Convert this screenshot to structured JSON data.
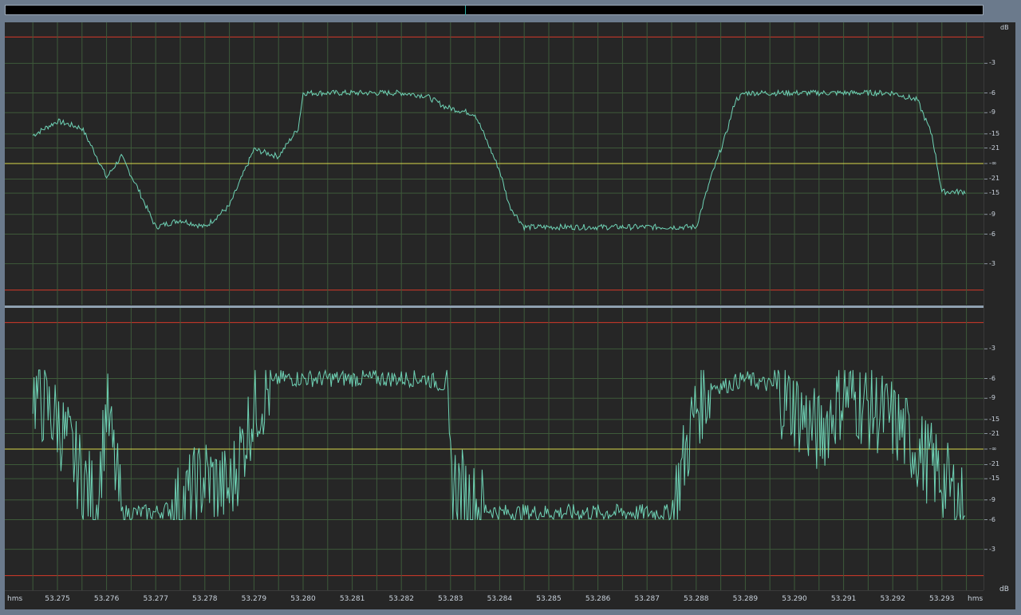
{
  "overview": {
    "playhead_fraction": 0.47
  },
  "display": {
    "db_unit": "dB",
    "time_unit": "hms",
    "colors": {
      "background": "#262626",
      "grid": "#3e5a3a",
      "waveform": "#6fd3b6",
      "clip_line": "#d43a2a",
      "center_line": "#d8d84a",
      "text": "#c9d2dc"
    }
  },
  "channels": [
    {
      "name": "top-channel",
      "db_labels": [
        "-3",
        "-6",
        "-9",
        "-15",
        "-21",
        "-∞",
        "-21",
        "-15",
        "-9",
        "-6",
        "-3"
      ]
    },
    {
      "name": "bottom-channel",
      "db_labels": [
        "-3",
        "-6",
        "-9",
        "-15",
        "-21",
        "-∞",
        "-21",
        "-15",
        "-9",
        "-6",
        "-3"
      ]
    }
  ],
  "time_axis": {
    "ticks": [
      "53.275",
      "53.276",
      "53.277",
      "53.278",
      "53.279",
      "53.280",
      "53.281",
      "53.282",
      "53.283",
      "53.284",
      "53.285",
      "53.286",
      "53.287",
      "53.288",
      "53.289",
      "53.290",
      "53.291",
      "53.292",
      "53.293"
    ]
  },
  "chart_data": {
    "type": "line",
    "xlabel": "hms",
    "ylabel": "dB",
    "series": [
      {
        "values_time": [
          53.2745,
          53.275,
          53.2755,
          53.2758,
          53.276,
          53.2763,
          53.2766,
          53.277,
          53.2775,
          53.278,
          53.2785,
          53.279,
          53.2795,
          53.2799,
          53.28,
          53.2805,
          53.281,
          53.2815,
          53.282,
          53.2825,
          53.2829,
          53.2835,
          53.284,
          53.2842,
          53.2845,
          53.285,
          53.2855,
          53.286,
          53.2865,
          53.287,
          53.2875,
          53.288,
          53.2883,
          53.2886,
          53.2888,
          53.289,
          53.2895,
          53.29,
          53.2905,
          53.291,
          53.2915,
          53.292,
          53.2925,
          53.2928,
          53.293,
          53.2935
        ],
        "values_amp": [
          0.2,
          0.3,
          0.25,
          0.05,
          -0.1,
          0.05,
          -0.15,
          -0.45,
          -0.4,
          -0.45,
          -0.3,
          0.1,
          0.05,
          0.25,
          0.5,
          0.5,
          0.5,
          0.5,
          0.5,
          0.48,
          0.4,
          0.35,
          -0.05,
          -0.3,
          -0.45,
          -0.45,
          -0.45,
          -0.45,
          -0.45,
          -0.45,
          -0.45,
          -0.45,
          -0.1,
          0.2,
          0.45,
          0.5,
          0.5,
          0.5,
          0.5,
          0.5,
          0.5,
          0.5,
          0.45,
          0.2,
          -0.2,
          -0.2
        ]
      },
      {
        "values_time": [
          53.2745,
          53.275,
          53.2755,
          53.2758,
          53.276,
          53.2763,
          53.2766,
          53.277,
          53.2775,
          53.278,
          53.2785,
          53.279,
          53.2795,
          53.28,
          53.2805,
          53.281,
          53.2815,
          53.282,
          53.2825,
          53.2829,
          53.283,
          53.2835,
          53.284,
          53.2845,
          53.285,
          53.2855,
          53.286,
          53.2865,
          53.287,
          53.2875,
          53.288,
          53.2883,
          53.2886,
          53.289,
          53.2895,
          53.29,
          53.2905,
          53.291,
          53.2915,
          53.292,
          53.2925,
          53.293,
          53.2935
        ],
        "values_amp": [
          0.4,
          0.2,
          -0.2,
          -0.4,
          0.3,
          -0.45,
          -0.45,
          -0.45,
          -0.4,
          -0.2,
          -0.3,
          0.3,
          0.5,
          0.5,
          0.5,
          0.5,
          0.5,
          0.5,
          0.5,
          0.45,
          -0.2,
          -0.4,
          -0.45,
          -0.45,
          -0.45,
          -0.45,
          -0.45,
          -0.45,
          -0.45,
          -0.45,
          0.3,
          0.45,
          0.45,
          0.5,
          0.45,
          0.3,
          0.1,
          0.4,
          0.3,
          0.2,
          0.0,
          -0.2,
          -0.45
        ]
      }
    ]
  }
}
